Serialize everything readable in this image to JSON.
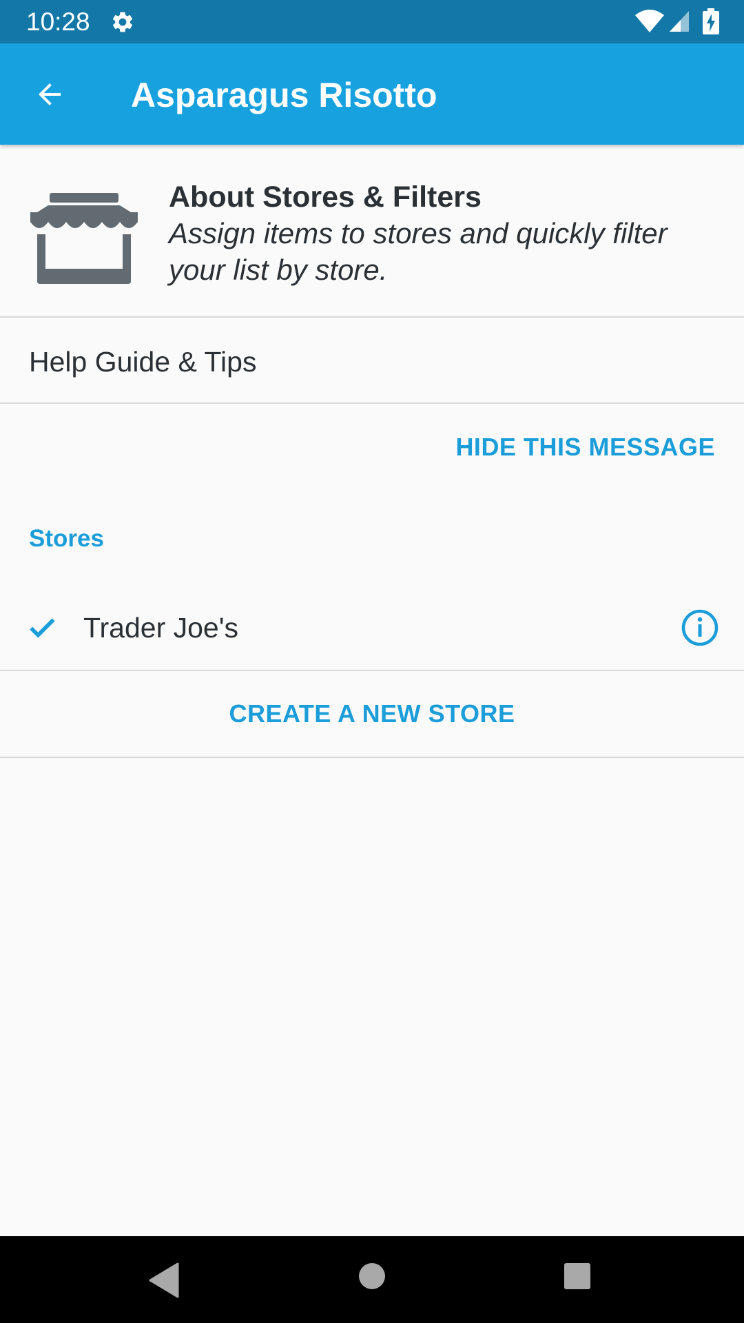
{
  "status_bar": {
    "time": "10:28",
    "icons": [
      "gear-icon",
      "wifi-icon",
      "cell-signal-icon",
      "battery-charging-icon"
    ]
  },
  "app_bar": {
    "title": "Asparagus Risotto",
    "back_icon": "arrow-left-icon",
    "color": "#18a1df"
  },
  "info_card": {
    "icon": "storefront-icon",
    "title": "About Stores & Filters",
    "body": "Assign items to stores and quickly filter your list by store."
  },
  "help": {
    "label": "Help Guide & Tips"
  },
  "hide_message": {
    "label": "HIDE THIS MESSAGE"
  },
  "stores": {
    "header": "Stores",
    "items": [
      {
        "name": "Trader Joe's",
        "checked": true,
        "info_icon": "info-circle-icon"
      }
    ],
    "create_label": "CREATE A NEW STORE"
  },
  "nav_bar": {
    "icons": [
      "nav-back-icon",
      "nav-home-icon",
      "nav-recents-icon"
    ]
  },
  "colors": {
    "accent": "#1a9dd9",
    "status_bar": "#1378a8",
    "text": "#2b3035",
    "background": "#fafafa"
  }
}
